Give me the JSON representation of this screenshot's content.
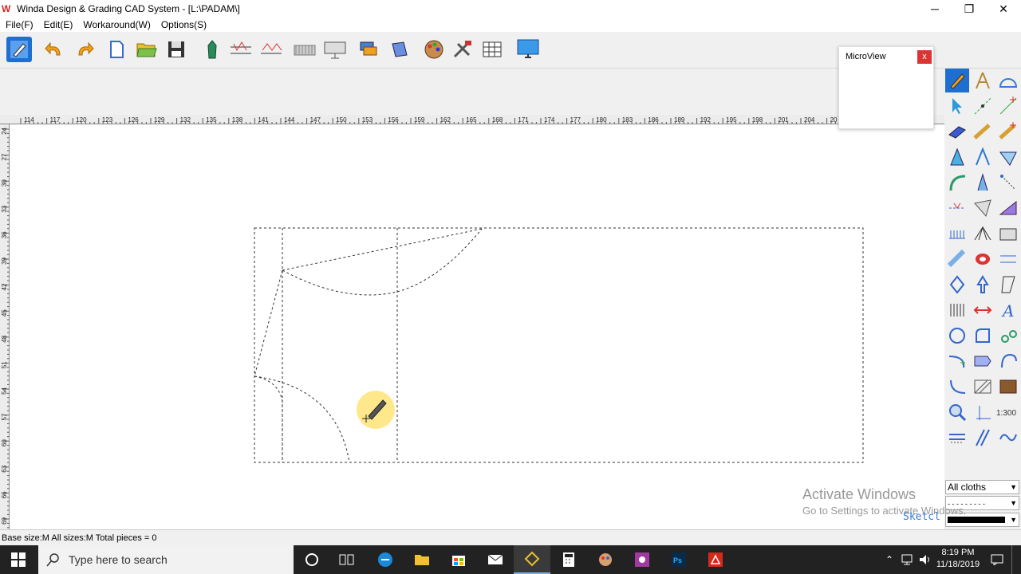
{
  "window": {
    "title": "Winda Design & Grading CAD System - [L:\\PADAM\\]",
    "app_icon": "W",
    "minimize": "─",
    "restore": "❐",
    "close": "✕"
  },
  "menu": [
    "File(F)",
    "Edit(E)",
    "Workaround(W)",
    "Options(S)"
  ],
  "toolbar_icons": [
    "pencil-icon",
    "undo-icon",
    "redo-icon",
    "new-file-icon",
    "open-folder-icon",
    "save-icon",
    "piece-icon",
    "measure-icon",
    "grade-icon",
    "cut-table-icon",
    "plotter-icon",
    "layer-icon",
    "cube-icon",
    "palette-icon",
    "tools-icon",
    "grid-icon",
    "monitor-icon"
  ],
  "microview": {
    "title": "MicroView",
    "close": "x"
  },
  "ruler": {
    "h_labels": [
      "114",
      "117",
      "120",
      "123",
      "126",
      "129",
      "132",
      "135",
      "138",
      "141",
      "144",
      "147",
      "150",
      "153",
      "156",
      "159",
      "162",
      "165",
      "168",
      "171",
      "174",
      "177",
      "180",
      "183",
      "186",
      "189",
      "192",
      "195",
      "198",
      "201",
      "204",
      "20"
    ],
    "v_labels": [
      "24",
      "27",
      "30",
      "33",
      "36",
      "39",
      "42",
      "45",
      "48",
      "51",
      "54",
      "57",
      "60",
      "63",
      "66",
      "69"
    ]
  },
  "side_controls": {
    "cloth_select": "All cloths",
    "line_style": "- - - - - - - - -",
    "line_weight": ""
  },
  "status": "Base size:M All sizes:M  Total pieces = 0",
  "watermark": {
    "line1": "Activate Windows",
    "line2": "Go to Settings to activate Windows."
  },
  "sketch_label": "Sketcl",
  "palette_scale_label": "1:300",
  "taskbar": {
    "search_placeholder": "Type here to search",
    "time": "8:19 PM",
    "date": "11/18/2019"
  },
  "colors": {
    "accent": "#1f6fd1",
    "taskbar": "#222222",
    "watermark": "#999999"
  }
}
